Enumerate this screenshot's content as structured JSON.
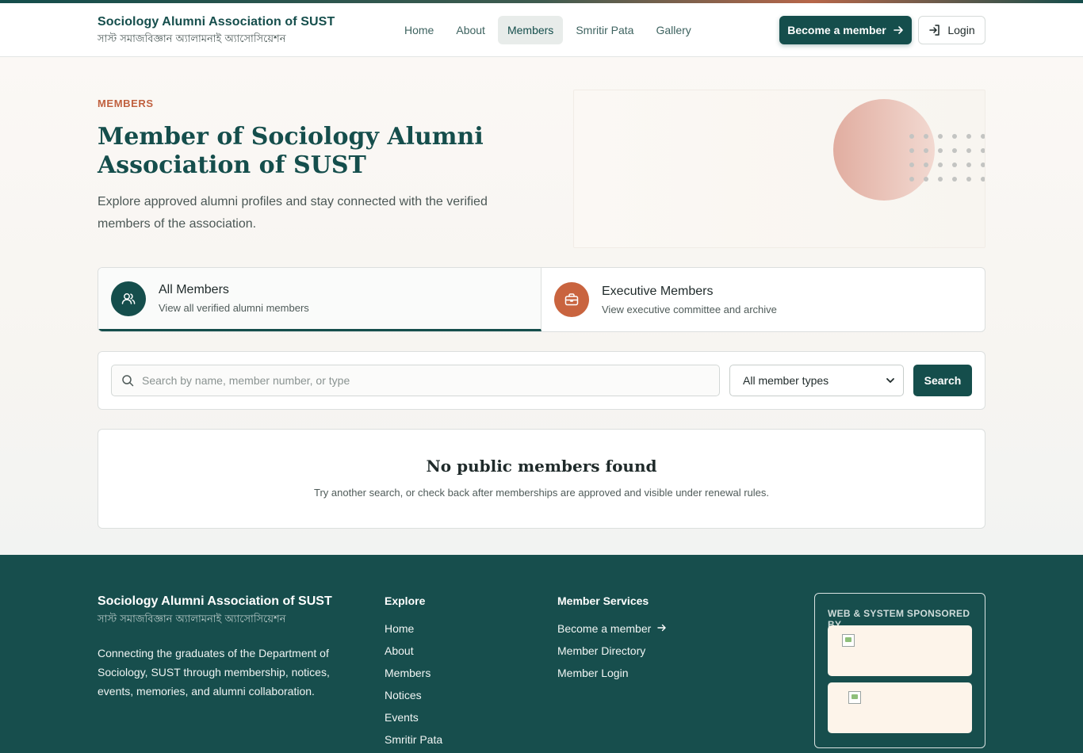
{
  "header": {
    "brand_title": "Sociology Alumni Association of SUST",
    "brand_subtitle": "সাস্ট সমাজবিজ্ঞান অ্যালামনাই অ্যাসোসিয়েশন",
    "nav": [
      {
        "label": "Home",
        "active": false
      },
      {
        "label": "About",
        "active": false
      },
      {
        "label": "Members",
        "active": true
      },
      {
        "label": "Smritir Pata",
        "active": false
      },
      {
        "label": "Gallery",
        "active": false
      }
    ],
    "become_member_label": "Become a member",
    "login_label": "Login"
  },
  "hero": {
    "eyebrow": "MEMBERS",
    "title": "Member of Sociology Alumni Association of SUST",
    "description": "Explore approved alumni profiles and stay connected with the verified members of the association."
  },
  "tabs": [
    {
      "title": "All Members",
      "subtitle": "View all verified alumni members",
      "active": true,
      "icon": "users-icon"
    },
    {
      "title": "Executive Members",
      "subtitle": "View executive committee and archive",
      "active": false,
      "icon": "briefcase-icon"
    }
  ],
  "search": {
    "placeholder": "Search by name, member number, or type",
    "value": "",
    "filter_selected": "All member types",
    "button_label": "Search"
  },
  "empty_state": {
    "title": "No public members found",
    "text": "Try another search, or check back after memberships are approved and visible under renewal rules."
  },
  "footer": {
    "brand_title": "Sociology Alumni Association of SUST",
    "brand_subtitle": "সাস্ট সমাজবিজ্ঞান অ্যালামনাই অ্যাসোসিয়েশন",
    "description": "Connecting the graduates of the Department of Sociology, SUST through membership, notices, events, memories, and alumni collaboration.",
    "explore_title": "Explore",
    "explore_links": [
      "Home",
      "About",
      "Members",
      "Notices",
      "Events",
      "Smritir Pata"
    ],
    "services_title": "Member Services",
    "services_links": [
      "Become a member",
      "Member Directory",
      "Member Login"
    ],
    "sponsor_title": "WEB & SYSTEM SPONSORED BY"
  },
  "colors": {
    "primary": "#154e4c",
    "accent": "#c0613f",
    "footer_bg": "#174e4d"
  }
}
